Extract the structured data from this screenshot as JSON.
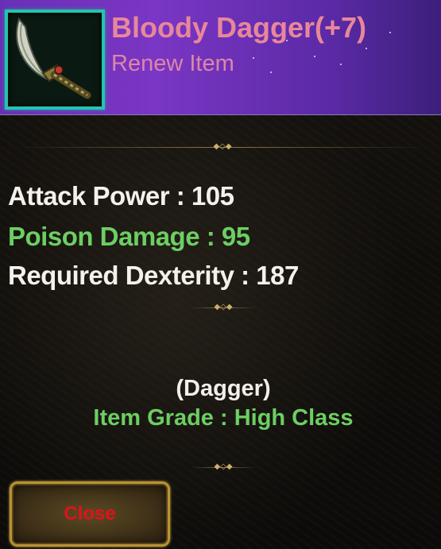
{
  "item": {
    "name": "Bloody Dagger(+7)",
    "subtitle": "Renew Item",
    "icon": "curved-dagger-icon"
  },
  "stats": [
    {
      "text": "Attack Power : 105",
      "color": "#f4f1ea"
    },
    {
      "text": "Poison Damage : 95",
      "color": "#6ccf62"
    },
    {
      "text": "Required Dexterity : 187",
      "color": "#f4f1ea"
    }
  ],
  "info": {
    "type": "(Dagger)",
    "grade": "Item Grade : High Class"
  },
  "buttons": {
    "close_label": "Close"
  },
  "colors": {
    "header_accent": "#7a36c4",
    "name": "#e9879a",
    "subtitle": "#dd86a8",
    "icon_frame": "#25c4b0",
    "button_border": "#b89432",
    "close_text": "#e0121a"
  }
}
